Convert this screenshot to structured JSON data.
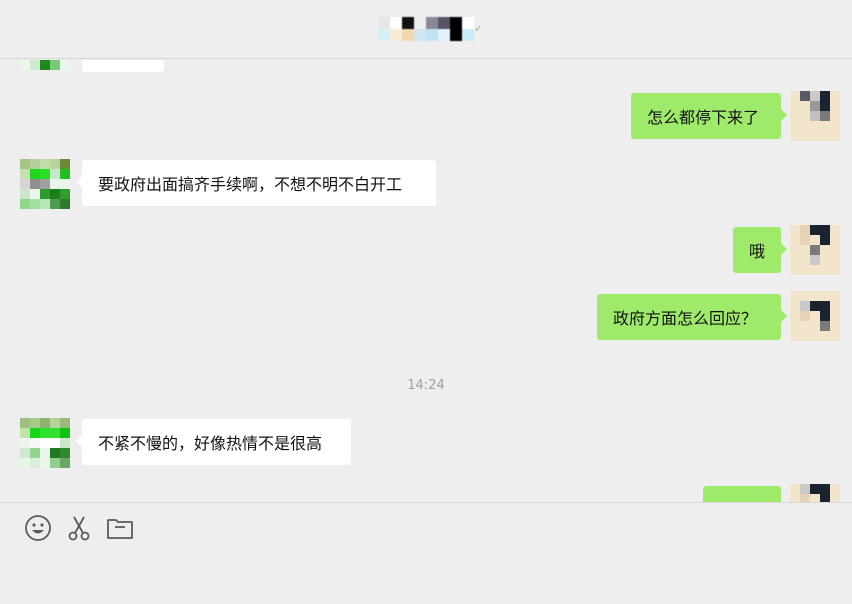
{
  "header": {
    "title_blurred": ""
  },
  "messages": [
    {
      "side": "in",
      "text": ""
    },
    {
      "side": "out",
      "text": "怎么都停下来了"
    },
    {
      "side": "in",
      "text": "要政府出面搞齐手续啊，不想不明不白开工"
    },
    {
      "side": "out",
      "text": "哦"
    },
    {
      "side": "out",
      "text": "政府方面怎么回应？"
    },
    {
      "side": "in",
      "text": "不紧不慢的，好像热情不是很高"
    },
    {
      "side": "out",
      "text": ""
    }
  ],
  "timestamp": "14:24",
  "toolbar": {
    "icons": [
      "emoji-icon",
      "scissors-icon",
      "folder-icon"
    ]
  },
  "colors": {
    "background": "#eeeeee",
    "outgoing_bubble": "#9eea6a",
    "incoming_bubble": "#ffffff"
  }
}
